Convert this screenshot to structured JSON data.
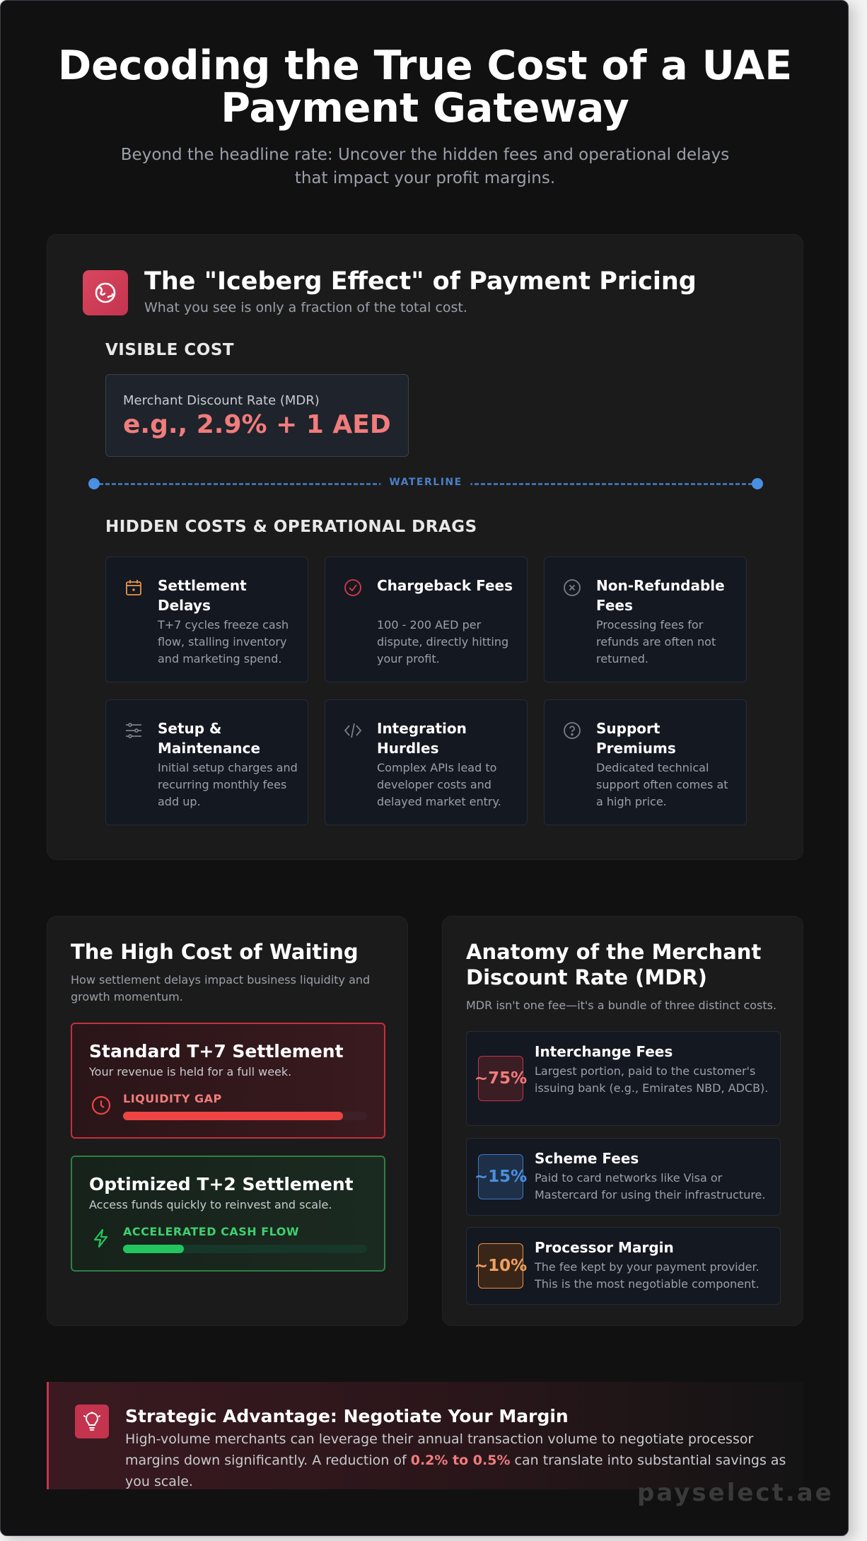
{
  "header": {
    "title": "Decoding the True Cost of a UAE Payment Gateway",
    "subtitle": "Beyond the headline rate: Uncover the hidden fees and operational delays that impact your profit margins."
  },
  "iceberg": {
    "title": "The \"Iceberg Effect\" of Payment Pricing",
    "subtitle": "What you see is only a fraction of the total cost.",
    "icon": "iceberg-icon",
    "visible_label": "VISIBLE COST",
    "mdr_label": "Merchant Discount Rate (MDR)",
    "mdr_value": "e.g., 2.9% + 1 AED",
    "waterline_label": "WATERLINE",
    "hidden_label": "HIDDEN COSTS & OPERATIONAL DRAGS",
    "costs": [
      {
        "title": "Settlement Delays",
        "desc": "T+7 cycles freeze cash flow, stalling inventory and marketing spend.",
        "icon": "calendar-icon",
        "color": "#e8954a"
      },
      {
        "title": "Chargeback Fees",
        "desc": "100 - 200 AED per dispute, directly hitting your profit.",
        "icon": "check-circle-icon",
        "color": "#d93a4a"
      },
      {
        "title": "Non-Refundable Fees",
        "desc": "Processing fees for refunds are often not returned.",
        "icon": "x-circle-icon",
        "color": "#7a808a"
      },
      {
        "title": "Setup & Maintenance",
        "desc": "Initial setup charges and recurring monthly fees add up.",
        "icon": "sliders-icon",
        "color": "#7a808a"
      },
      {
        "title": "Integration Hurdles",
        "desc": "Complex APIs lead to developer costs and delayed market entry.",
        "icon": "code-icon",
        "color": "#7a808a"
      },
      {
        "title": "Support Premiums",
        "desc": "Dedicated technical support often comes at a high price.",
        "icon": "question-circle-icon",
        "color": "#7a808a"
      }
    ]
  },
  "waiting": {
    "title": "The High Cost of Waiting",
    "desc": "How settlement delays impact business liquidity and growth momentum.",
    "standard": {
      "title": "Standard T+7 Settlement",
      "sub": "Your revenue is held for a full week.",
      "tag": "LIQUIDITY GAP",
      "level": 0.9,
      "color": "#ef4444",
      "icon": "clock-icon"
    },
    "optimized": {
      "title": "Optimized T+2 Settlement",
      "sub": "Access funds quickly to reinvest and scale.",
      "tag": "ACCELERATED CASH FLOW",
      "level": 0.25,
      "color": "#22c55e",
      "icon": "lightning-icon"
    }
  },
  "anatomy": {
    "title": "Anatomy of the Merchant Discount Rate (MDR)",
    "desc": "MDR isn't one fee—it's a bundle of three distinct costs.",
    "items": [
      {
        "pct": "~75%",
        "title": "Interchange Fees",
        "desc": "Largest portion, paid to the customer's issuing bank (e.g., Emirates NBD, ADCB).",
        "color": "#f07c7c"
      },
      {
        "pct": "~15%",
        "title": "Scheme Fees",
        "desc": "Paid to card networks like Visa or Mastercard for using their infrastructure.",
        "color": "#4a90e2"
      },
      {
        "pct": "~10%",
        "title": "Processor Margin",
        "desc": "The fee kept by your payment provider. This is the most negotiable component.",
        "color": "#f0a060"
      }
    ]
  },
  "strategic": {
    "title": "Strategic Advantage: Negotiate Your Margin",
    "text_before": "High-volume merchants can leverage their annual transaction volume to negotiate processor margins down significantly. A reduction of ",
    "highlight": "0.2% to 0.5%",
    "text_after": " can translate into substantial savings as you scale.",
    "icon": "lightbulb-icon"
  },
  "watermark": "payselect.ae"
}
